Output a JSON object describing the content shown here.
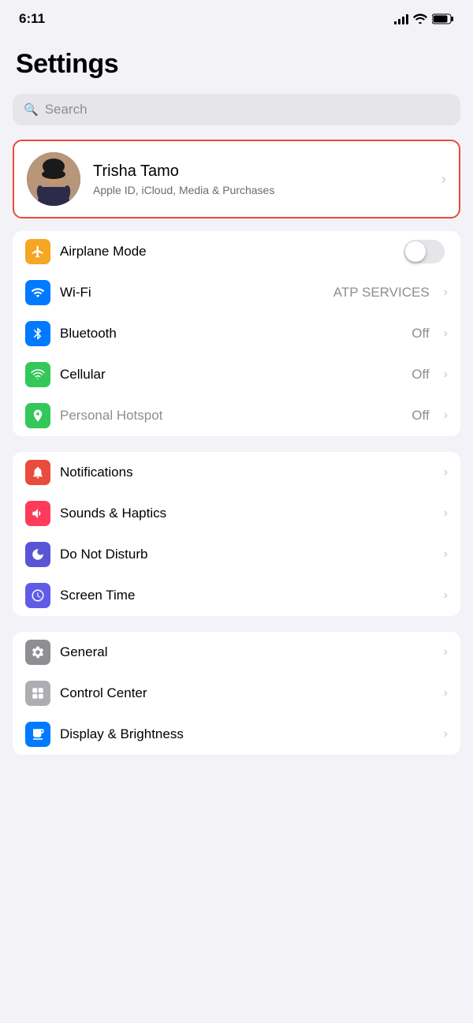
{
  "statusBar": {
    "time": "6:11"
  },
  "header": {
    "title": "Settings"
  },
  "search": {
    "placeholder": "Search"
  },
  "profile": {
    "name": "Trisha Tamo",
    "subtitle": "Apple ID, iCloud, Media & Purchases"
  },
  "groups": [
    {
      "id": "connectivity",
      "items": [
        {
          "label": "Airplane Mode",
          "value": "",
          "hasToggle": true,
          "iconClass": "icon-orange",
          "iconType": "airplane",
          "dimmed": false
        },
        {
          "label": "Wi-Fi",
          "value": "ATP SERVICES",
          "hasToggle": false,
          "iconClass": "icon-blue",
          "iconType": "wifi",
          "dimmed": false
        },
        {
          "label": "Bluetooth",
          "value": "Off",
          "hasToggle": false,
          "iconClass": "icon-blue-dark",
          "iconType": "bluetooth",
          "dimmed": false
        },
        {
          "label": "Cellular",
          "value": "Off",
          "hasToggle": false,
          "iconClass": "icon-green",
          "iconType": "cellular",
          "dimmed": false
        },
        {
          "label": "Personal Hotspot",
          "value": "Off",
          "hasToggle": false,
          "iconClass": "icon-green-light",
          "iconType": "hotspot",
          "dimmed": true
        }
      ]
    },
    {
      "id": "notifications",
      "items": [
        {
          "label": "Notifications",
          "value": "",
          "hasToggle": false,
          "iconClass": "icon-red",
          "iconType": "notifications",
          "dimmed": false
        },
        {
          "label": "Sounds & Haptics",
          "value": "",
          "hasToggle": false,
          "iconClass": "icon-pink",
          "iconType": "sounds",
          "dimmed": false
        },
        {
          "label": "Do Not Disturb",
          "value": "",
          "hasToggle": false,
          "iconClass": "icon-purple",
          "iconType": "donotdisturb",
          "dimmed": false
        },
        {
          "label": "Screen Time",
          "value": "",
          "hasToggle": false,
          "iconClass": "icon-indigo",
          "iconType": "screentime",
          "dimmed": false
        }
      ]
    },
    {
      "id": "general",
      "items": [
        {
          "label": "General",
          "value": "",
          "hasToggle": false,
          "iconClass": "icon-gray",
          "iconType": "general",
          "dimmed": false
        },
        {
          "label": "Control Center",
          "value": "",
          "hasToggle": false,
          "iconClass": "icon-gray2",
          "iconType": "controlcenter",
          "dimmed": false
        },
        {
          "label": "Display & Brightness",
          "value": "",
          "hasToggle": false,
          "iconClass": "icon-blue",
          "iconType": "display",
          "dimmed": false
        }
      ]
    }
  ]
}
